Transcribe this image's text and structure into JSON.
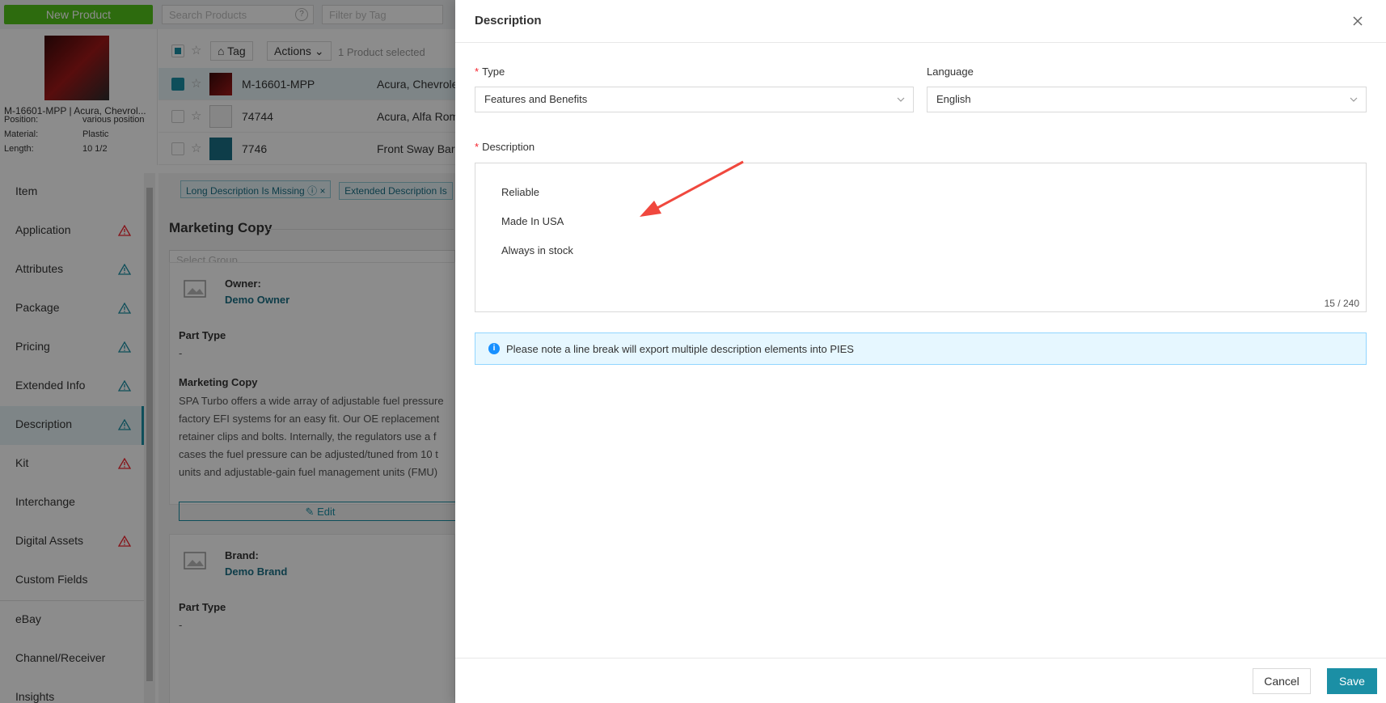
{
  "toolbar": {
    "new_product": "New Product",
    "search_placeholder": "Search Products",
    "filter_placeholder": "Filter by Tag"
  },
  "preview": {
    "title": "M-16601-MPP | Acura, Chevrol...",
    "specs": [
      {
        "label": "Position:",
        "value": "various position"
      },
      {
        "label": "Material:",
        "value": "Plastic"
      },
      {
        "label": "Length:",
        "value": "10 1/2"
      }
    ]
  },
  "list": {
    "tag_button": "Tag",
    "actions_button": "Actions",
    "selected_count": "1 Product selected",
    "rows": [
      {
        "sku": "M-16601-MPP",
        "make": "Acura, Chevrole",
        "selected": true
      },
      {
        "sku": "74744",
        "make": "Acura, Alfa Rom",
        "selected": false
      },
      {
        "sku": "7746",
        "make": "Front Sway Bar",
        "selected": false
      }
    ]
  },
  "sidebar": {
    "items": [
      {
        "label": "Item",
        "warn": ""
      },
      {
        "label": "Application",
        "warn": "red"
      },
      {
        "label": "Attributes",
        "warn": "teal"
      },
      {
        "label": "Package",
        "warn": "teal"
      },
      {
        "label": "Pricing",
        "warn": "teal"
      },
      {
        "label": "Extended Info",
        "warn": "teal"
      },
      {
        "label": "Description",
        "warn": "teal"
      },
      {
        "label": "Kit",
        "warn": "red"
      },
      {
        "label": "Interchange",
        "warn": ""
      },
      {
        "label": "Digital Assets",
        "warn": "red"
      },
      {
        "label": "Custom Fields",
        "warn": ""
      },
      {
        "label": "eBay",
        "warn": ""
      },
      {
        "label": "Channel/Receiver",
        "warn": ""
      },
      {
        "label": "Insights",
        "warn": ""
      }
    ],
    "active": "Description"
  },
  "content": {
    "chips": [
      "Long Description Is Missing",
      "Extended Description Is"
    ],
    "section_title": "Marketing Copy",
    "select_group_placeholder": "Select Group",
    "owner_card": {
      "owner_label": "Owner:",
      "owner_value": "Demo Owner",
      "part_type_label": "Part Type",
      "part_type_value": "-",
      "marketing_label": "Marketing Copy",
      "marketing_lines": [
        "SPA Turbo offers a wide array of adjustable fuel pressure",
        "factory EFI systems for an easy fit. Our OE replacement",
        "retainer clips and bolts. Internally, the regulators use a f",
        "cases the fuel pressure can be adjusted/tuned from 10 t",
        "units and adjustable-gain fuel management units (FMU)"
      ],
      "edit_label": "Edit"
    },
    "brand_card": {
      "brand_label": "Brand:",
      "brand_value": "Demo Brand",
      "part_type_label": "Part Type",
      "part_type_value": "-"
    }
  },
  "drawer": {
    "title": "Description",
    "type_label": "Type",
    "type_value": "Features and Benefits",
    "language_label": "Language",
    "language_value": "English",
    "description_label": "Description",
    "description_lines": [
      "Reliable",
      "Made In USA",
      "Always in stock"
    ],
    "counter": "15 / 240",
    "note": "Please note a line break will export multiple description elements into PIES",
    "cancel": "Cancel",
    "save": "Save"
  },
  "colors": {
    "accent": "#1b8fa5",
    "new_button": "#52c41a",
    "warn_red": "#f5222d",
    "arrow": "#f0483e"
  }
}
